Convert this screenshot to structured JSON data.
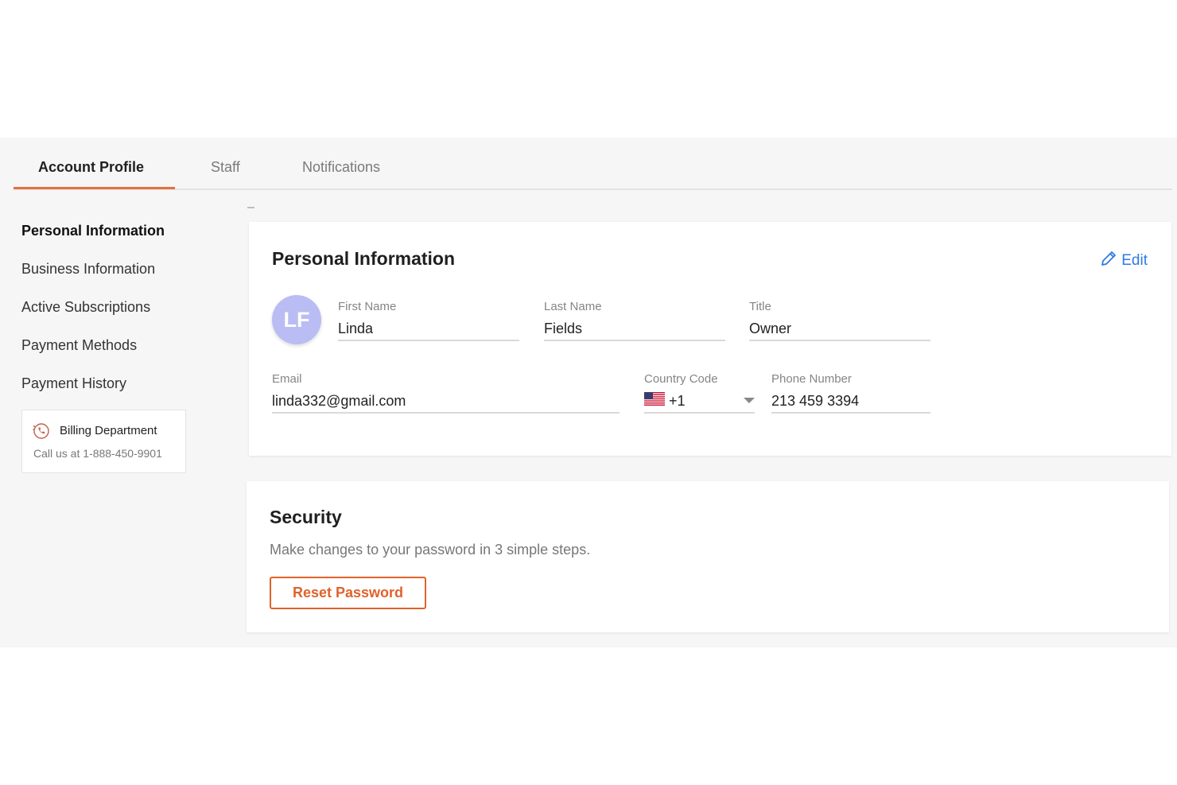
{
  "tabs": [
    {
      "label": "Account Profile",
      "active": true
    },
    {
      "label": "Staff",
      "active": false
    },
    {
      "label": "Notifications",
      "active": false
    }
  ],
  "sidebar": {
    "items": [
      {
        "label": "Personal Information",
        "active": true
      },
      {
        "label": "Business Information",
        "active": false
      },
      {
        "label": "Active Subscriptions",
        "active": false
      },
      {
        "label": "Payment Methods",
        "active": false
      },
      {
        "label": "Payment History",
        "active": false
      }
    ],
    "billing": {
      "title": "Billing Department",
      "subtitle": "Call us at 1-888-450-9901",
      "icon": "phone-icon"
    }
  },
  "personal": {
    "title": "Personal Information",
    "edit_label": "Edit",
    "avatar_initials": "LF",
    "first_name": {
      "label": "First Name",
      "value": "Linda"
    },
    "last_name": {
      "label": "Last Name",
      "value": "Fields"
    },
    "job_title": {
      "label": "Title",
      "value": "Owner"
    },
    "email": {
      "label": "Email",
      "value": "linda332@gmail.com"
    },
    "country_code": {
      "label": "Country Code",
      "value": "+1",
      "flag": "us-flag-icon"
    },
    "phone": {
      "label": "Phone Number",
      "value": "213 459 3394"
    }
  },
  "security": {
    "title": "Security",
    "description": "Make changes to your password in 3 simple steps.",
    "reset_label": "Reset Password"
  },
  "colors": {
    "accent": "#e6703a",
    "link": "#2f7ae5",
    "avatar_bg": "#b9bdf4"
  }
}
